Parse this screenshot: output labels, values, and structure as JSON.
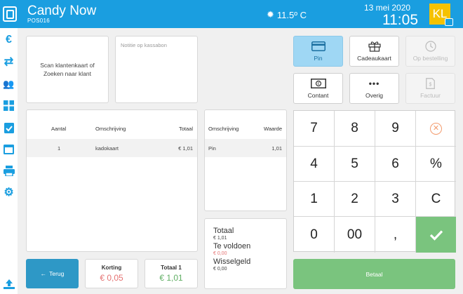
{
  "header": {
    "title": "Candy Now",
    "subtitle": "POS016",
    "temperature": "11.5º C",
    "date": "13 mei 2020",
    "time": "11:05",
    "user_initials": "KL"
  },
  "sidebar": {
    "items": [
      {
        "name": "euro-icon",
        "glyph": "€"
      },
      {
        "name": "transfer-icon",
        "glyph": "⇄"
      },
      {
        "name": "customers-icon",
        "glyph": "👥"
      },
      {
        "name": "dashboard-icon",
        "glyph": "▦"
      },
      {
        "name": "clipboard-check-icon",
        "glyph": "✔"
      },
      {
        "name": "calendar-icon",
        "glyph": "▬"
      },
      {
        "name": "printer-icon",
        "glyph": "⎙"
      },
      {
        "name": "settings-icon",
        "glyph": "⚙"
      },
      {
        "name": "upload-icon",
        "glyph": "⇪"
      }
    ]
  },
  "scan_box": {
    "text_line1": "Scan klantenkaart of",
    "text_line2": "Zoeken naar klant"
  },
  "note_box": {
    "placeholder": "Notitie op kassabon"
  },
  "items_table": {
    "headers": {
      "qty": "Aantal",
      "desc": "Omschrijving",
      "total": "Totaal"
    },
    "rows": [
      {
        "qty": "1",
        "desc": "kadokaart",
        "total": "€ 1,01"
      }
    ]
  },
  "payments_table": {
    "headers": {
      "desc": "Omschrijving",
      "value": "Waarde"
    },
    "rows": [
      {
        "desc": "Pin",
        "value": "1,01"
      }
    ]
  },
  "totals": {
    "total_label": "Totaal",
    "total_value": "€ 1,01",
    "due_label": "Te voldoen",
    "due_value": "€ 0,00",
    "change_label": "Wisselgeld",
    "change_value": "€ 0,00"
  },
  "payment_methods": [
    {
      "label": "Pin",
      "icon": "card-icon",
      "state": "active"
    },
    {
      "label": "Cadeaukaart",
      "icon": "gift-icon",
      "state": "normal"
    },
    {
      "label": "Op bestelling",
      "icon": "clock-icon",
      "state": "disabled"
    },
    {
      "label": "Contant",
      "icon": "banknote-icon",
      "state": "normal"
    },
    {
      "label": "Overig",
      "icon": "dots-icon",
      "state": "normal"
    },
    {
      "label": "Factuur",
      "icon": "invoice-icon",
      "state": "disabled"
    }
  ],
  "keypad": {
    "keys": [
      "7",
      "8",
      "9",
      "⊗",
      "4",
      "5",
      "6",
      "%",
      "1",
      "2",
      "3",
      "C",
      "0",
      "00",
      ",",
      "✔"
    ]
  },
  "footer": {
    "back_label": "Terug",
    "discount_label": "Korting",
    "discount_value": "€ 0,05",
    "total1_label": "Totaal 1",
    "total1_value": "€ 1,01",
    "pay_label": "Betaal"
  },
  "colors": {
    "accent": "#1a9ee0",
    "success": "#7ac47e",
    "danger": "#e57373",
    "user_badge": "#f5c200"
  }
}
